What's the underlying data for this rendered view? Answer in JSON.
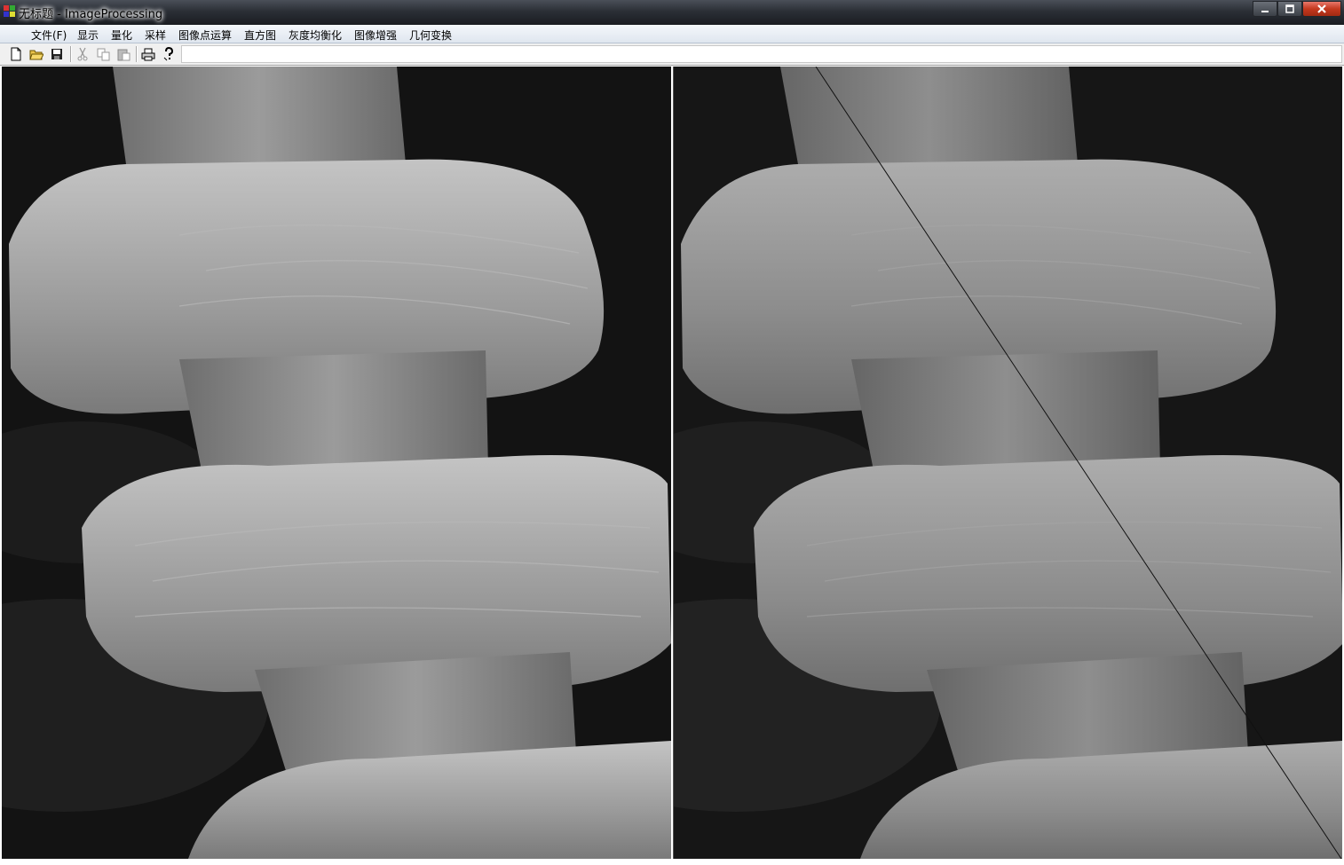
{
  "window": {
    "title": "无标题 - ImageProcessing",
    "controls": [
      "minimize",
      "maximize",
      "close"
    ]
  },
  "menu": {
    "items": [
      "文件(F)",
      "显示",
      "量化",
      "采样",
      "图像点运算",
      "直方图",
      "灰度均衡化",
      "图像增强",
      "几何变换"
    ]
  },
  "toolbar": {
    "icons": [
      "new-file-icon",
      "open-folder-icon",
      "save-icon",
      "cut-icon",
      "copy-icon",
      "paste-icon",
      "print-icon",
      "help-icon"
    ]
  },
  "images": {
    "left": {
      "subject": "grayscale micrograph",
      "variant": "original"
    },
    "right": {
      "subject": "grayscale micrograph",
      "variant": "processed (smoothed, diagonal line artifact)"
    }
  },
  "colors": {
    "titlebar": "#2b2f36",
    "close": "#c4391f",
    "menubar": "#e6ecf3",
    "image_bg": "#121212"
  }
}
